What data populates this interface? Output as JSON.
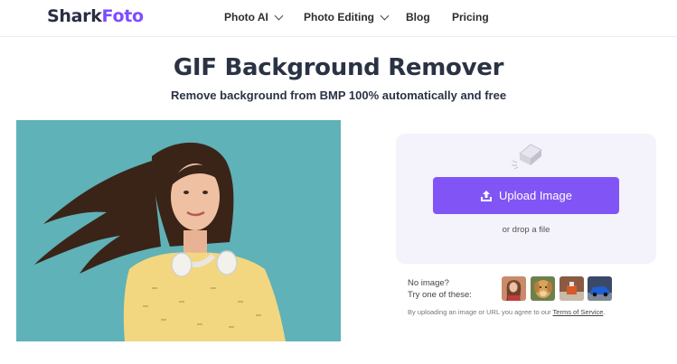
{
  "brand": {
    "part1": "Shark",
    "part2": "Foto"
  },
  "nav": {
    "photo_ai": "Photo AI",
    "photo_editing": "Photo Editing",
    "blog": "Blog",
    "pricing": "Pricing"
  },
  "hero": {
    "title": "GIF Background Remover",
    "subtitle": "Remove background from BMP 100% automatically and free"
  },
  "upload": {
    "button_label": "Upload Image",
    "drop_text": "or drop a file"
  },
  "samples": {
    "line1": "No image?",
    "line2": "Try one of these:",
    "items": [
      "woman-thumbnail",
      "dog-thumbnail",
      "product-thumbnail",
      "car-thumbnail"
    ]
  },
  "terms": {
    "prefix": "By uploading an image or URL you agree to our ",
    "link": "Terms of Service",
    "suffix": "."
  },
  "colors": {
    "brand_purple": "#7c4dff",
    "button_purple": "#8155f5",
    "demo_bg": "#5fb2b7",
    "card_bg": "#f4f2fb"
  }
}
